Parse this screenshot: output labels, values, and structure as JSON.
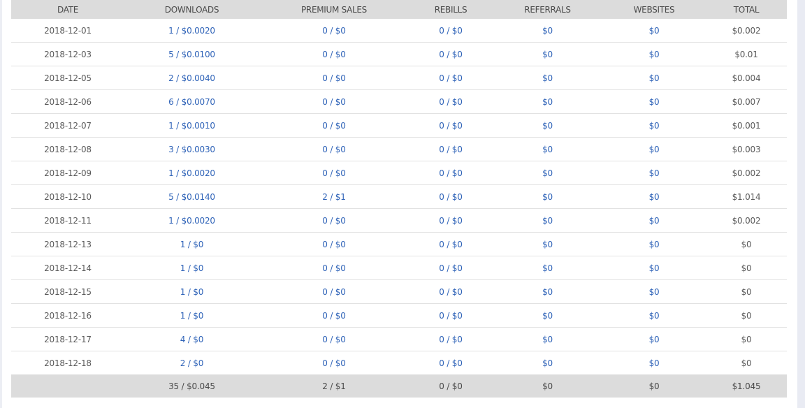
{
  "table": {
    "headers": [
      "DATE",
      "DOWNLOADS",
      "PREMIUM SALES",
      "REBILLS",
      "REFERRALS",
      "WEBSITES",
      "TOTAL"
    ],
    "rows": [
      [
        "2018-12-01",
        "1 / $0.0020",
        "0 / $0",
        "0 / $0",
        "$0",
        "$0",
        "$0.002"
      ],
      [
        "2018-12-03",
        "5 / $0.0100",
        "0 / $0",
        "0 / $0",
        "$0",
        "$0",
        "$0.01"
      ],
      [
        "2018-12-05",
        "2 / $0.0040",
        "0 / $0",
        "0 / $0",
        "$0",
        "$0",
        "$0.004"
      ],
      [
        "2018-12-06",
        "6 / $0.0070",
        "0 / $0",
        "0 / $0",
        "$0",
        "$0",
        "$0.007"
      ],
      [
        "2018-12-07",
        "1 / $0.0010",
        "0 / $0",
        "0 / $0",
        "$0",
        "$0",
        "$0.001"
      ],
      [
        "2018-12-08",
        "3 / $0.0030",
        "0 / $0",
        "0 / $0",
        "$0",
        "$0",
        "$0.003"
      ],
      [
        "2018-12-09",
        "1 / $0.0020",
        "0 / $0",
        "0 / $0",
        "$0",
        "$0",
        "$0.002"
      ],
      [
        "2018-12-10",
        "5 / $0.0140",
        "2 / $1",
        "0 / $0",
        "$0",
        "$0",
        "$1.014"
      ],
      [
        "2018-12-11",
        "1 / $0.0020",
        "0 / $0",
        "0 / $0",
        "$0",
        "$0",
        "$0.002"
      ],
      [
        "2018-12-13",
        "1 / $0",
        "0 / $0",
        "0 / $0",
        "$0",
        "$0",
        "$0"
      ],
      [
        "2018-12-14",
        "1 / $0",
        "0 / $0",
        "0 / $0",
        "$0",
        "$0",
        "$0"
      ],
      [
        "2018-12-15",
        "1 / $0",
        "0 / $0",
        "0 / $0",
        "$0",
        "$0",
        "$0"
      ],
      [
        "2018-12-16",
        "1 / $0",
        "0 / $0",
        "0 / $0",
        "$0",
        "$0",
        "$0"
      ],
      [
        "2018-12-17",
        "4 / $0",
        "0 / $0",
        "0 / $0",
        "$0",
        "$0",
        "$0"
      ],
      [
        "2018-12-18",
        "2 / $0",
        "0 / $0",
        "0 / $0",
        "$0",
        "$0",
        "$0"
      ]
    ],
    "totals": [
      "",
      "35 / $0.045",
      "2 / $1",
      "0 / $0",
      "$0",
      "$0",
      "$1.045"
    ]
  },
  "colors": {
    "header_bg": "#dcdcdc",
    "link": "#2f63b8",
    "text": "#4a4a4a",
    "row_divider": "#e2e2e2"
  }
}
